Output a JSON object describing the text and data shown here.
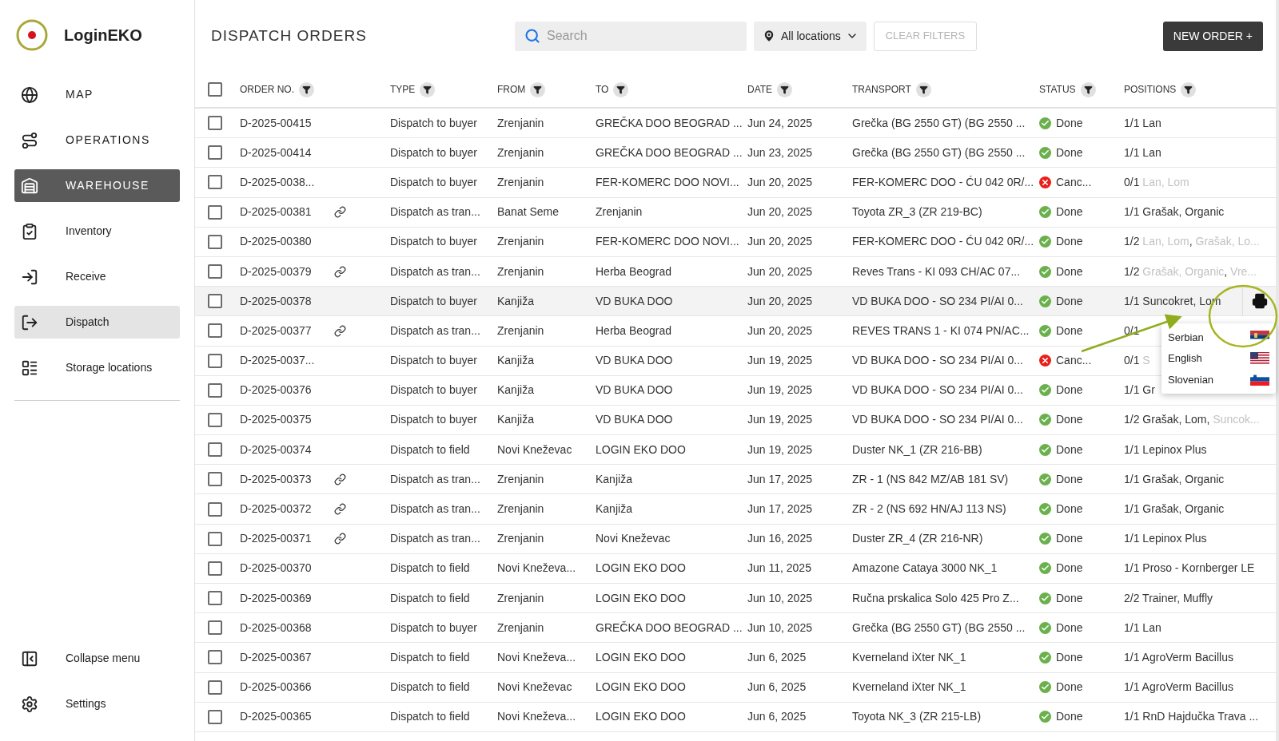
{
  "app": {
    "name": "LoginEKO"
  },
  "sidebar": {
    "items": [
      {
        "kind": "section",
        "label": "MAP",
        "selected": false
      },
      {
        "kind": "section",
        "label": "OPERATIONS",
        "selected": false
      },
      {
        "kind": "section",
        "label": "WAREHOUSE",
        "selected": true
      },
      {
        "kind": "item",
        "label": "Inventory",
        "selected": false
      },
      {
        "kind": "item",
        "label": "Receive",
        "selected": false
      },
      {
        "kind": "item",
        "label": "Dispatch",
        "selected": true
      },
      {
        "kind": "item",
        "label": "Storage locations",
        "selected": false
      }
    ],
    "footer": [
      {
        "label": "Collapse menu"
      },
      {
        "label": "Settings"
      }
    ]
  },
  "page": {
    "title": "DISPATCH ORDERS"
  },
  "toolbar": {
    "search": {
      "placeholder": "Search"
    },
    "location": {
      "value": "All locations"
    },
    "clear_filters": {
      "label": "CLEAR FILTERS",
      "disabled": true
    },
    "new_order": {
      "label": "NEW ORDER +"
    }
  },
  "table": {
    "select_all": {
      "checked": false
    },
    "columns": [
      "ORDER NO.",
      "TYPE",
      "FROM",
      "TO",
      "DATE",
      "TRANSPORT",
      "STATUS",
      "POSITIONS"
    ],
    "rows": [
      {
        "checked": false,
        "highlighted": false,
        "order": "D-2025-00415",
        "linked": false,
        "type": "Dispatch to buyer",
        "from": "Zrenjanin",
        "to": "GREČKA DOO BEOGRAD ...",
        "date": "Jun 24, 2025",
        "transport": "Grečka (BG 2550 GT) (BG 2550 ...",
        "status": {
          "kind": "done",
          "label": "Done"
        },
        "positions": {
          "count": "1/1",
          "parts": [
            {
              "text": "Lan",
              "muted": false
            }
          ]
        }
      },
      {
        "checked": false,
        "highlighted": false,
        "order": "D-2025-00414",
        "linked": false,
        "type": "Dispatch to buyer",
        "from": "Zrenjanin",
        "to": "GREČKA DOO BEOGRAD ...",
        "date": "Jun 23, 2025",
        "transport": "Grečka (BG 2550 GT) (BG 2550 ...",
        "status": {
          "kind": "done",
          "label": "Done"
        },
        "positions": {
          "count": "1/1",
          "parts": [
            {
              "text": "Lan",
              "muted": false
            }
          ]
        }
      },
      {
        "checked": false,
        "highlighted": false,
        "order": "D-2025-0038...",
        "linked": false,
        "type": "Dispatch to buyer",
        "from": "Zrenjanin",
        "to": "FER-KOMERC DOO NOVI...",
        "date": "Jun 20, 2025",
        "transport": "FER-KOMERC DOO - ĆU 042 0R/...",
        "status": {
          "kind": "cancelled",
          "label": "Canc..."
        },
        "positions": {
          "count": "0/1",
          "parts": [
            {
              "text": "Lan, Lom",
              "muted": true
            }
          ]
        }
      },
      {
        "checked": false,
        "highlighted": false,
        "order": "D-2025-00381",
        "linked": true,
        "type": "Dispatch as tran...",
        "from": "Banat Seme",
        "to": "Zrenjanin",
        "date": "Jun 20, 2025",
        "transport": "Toyota ZR_3 (ZR 219-BC)",
        "status": {
          "kind": "done",
          "label": "Done"
        },
        "positions": {
          "count": "1/1",
          "parts": [
            {
              "text": "Grašak, Organic",
              "muted": false
            }
          ]
        }
      },
      {
        "checked": false,
        "highlighted": false,
        "order": "D-2025-00380",
        "linked": false,
        "type": "Dispatch to buyer",
        "from": "Zrenjanin",
        "to": "FER-KOMERC DOO NOVI...",
        "date": "Jun 20, 2025",
        "transport": "FER-KOMERC DOO - ĆU 042 0R/...",
        "status": {
          "kind": "done",
          "label": "Done"
        },
        "positions": {
          "count": "1/2",
          "parts": [
            {
              "text": "Lan, Lom",
              "muted": true
            },
            {
              "text": ", ",
              "muted": false
            },
            {
              "text": "Grašak, Lo...",
              "muted": true
            }
          ]
        }
      },
      {
        "checked": false,
        "highlighted": false,
        "order": "D-2025-00379",
        "linked": true,
        "type": "Dispatch as tran...",
        "from": "Zrenjanin",
        "to": "Herba Beograd",
        "date": "Jun 20, 2025",
        "transport": "Reves Trans - KI 093 CH/AC 07...",
        "status": {
          "kind": "done",
          "label": "Done"
        },
        "positions": {
          "count": "1/2",
          "parts": [
            {
              "text": "Grašak, Organic",
              "muted": true
            },
            {
              "text": ", ",
              "muted": false
            },
            {
              "text": "Vre...",
              "muted": true
            }
          ]
        }
      },
      {
        "checked": false,
        "highlighted": true,
        "order": "D-2025-00378",
        "linked": false,
        "type": "Dispatch to buyer",
        "from": "Kanjiža",
        "to": "VD BUKA DOO",
        "date": "Jun 20, 2025",
        "transport": "VD BUKA DOO - SO 234 PI/AI 0...",
        "status": {
          "kind": "done",
          "label": "Done"
        },
        "positions": {
          "count": "1/1",
          "parts": [
            {
              "text": "Suncokret, Lom",
              "muted": false
            }
          ]
        }
      },
      {
        "checked": false,
        "highlighted": false,
        "order": "D-2025-00377",
        "linked": true,
        "type": "Dispatch as tran...",
        "from": "Zrenjanin",
        "to": "Herba Beograd",
        "date": "Jun 20, 2025",
        "transport": "REVES TRANS 1 - KI 074 PN/AC...",
        "status": {
          "kind": "done",
          "label": "Done"
        },
        "positions": {
          "count": "0/1"
        }
      },
      {
        "checked": false,
        "highlighted": false,
        "order": "D-2025-0037...",
        "linked": false,
        "type": "Dispatch to buyer",
        "from": "Kanjiža",
        "to": "VD BUKA DOO",
        "date": "Jun 19, 2025",
        "transport": "VD BUKA DOO - SO 234 PI/AI 0...",
        "status": {
          "kind": "cancelled",
          "label": "Canc..."
        },
        "positions": {
          "count": "0/1",
          "parts": [
            {
              "text": "S",
              "muted": true
            }
          ]
        }
      },
      {
        "checked": false,
        "highlighted": false,
        "order": "D-2025-00376",
        "linked": false,
        "type": "Dispatch to buyer",
        "from": "Kanjiža",
        "to": "VD BUKA DOO",
        "date": "Jun 19, 2025",
        "transport": "VD BUKA DOO - SO 234 PI/AI 0...",
        "status": {
          "kind": "done",
          "label": "Done"
        },
        "positions": {
          "count": "1/1",
          "parts": [
            {
              "text": "Gr",
              "muted": false
            }
          ]
        }
      },
      {
        "checked": false,
        "highlighted": false,
        "order": "D-2025-00375",
        "linked": false,
        "type": "Dispatch to buyer",
        "from": "Kanjiža",
        "to": "VD BUKA DOO",
        "date": "Jun 19, 2025",
        "transport": "VD BUKA DOO - SO 234 PI/AI 0...",
        "status": {
          "kind": "done",
          "label": "Done"
        },
        "positions": {
          "count": "1/2",
          "parts": [
            {
              "text": "Grašak, Lom, ",
              "muted": false
            },
            {
              "text": "Suncok...",
              "muted": true
            }
          ]
        }
      },
      {
        "checked": false,
        "highlighted": false,
        "order": "D-2025-00374",
        "linked": false,
        "type": "Dispatch to field",
        "from": "Novi Kneževac",
        "to": "LOGIN EKO DOO",
        "date": "Jun 19, 2025",
        "transport": "Duster NK_1 (ZR 216-BB)",
        "status": {
          "kind": "done",
          "label": "Done"
        },
        "positions": {
          "count": "1/1",
          "parts": [
            {
              "text": "Lepinox Plus",
              "muted": false
            }
          ]
        }
      },
      {
        "checked": false,
        "highlighted": false,
        "order": "D-2025-00373",
        "linked": true,
        "type": "Dispatch as tran...",
        "from": "Zrenjanin",
        "to": "Kanjiža",
        "date": "Jun 17, 2025",
        "transport": "ZR - 1 (NS 842 MZ/AB 181 SV)",
        "status": {
          "kind": "done",
          "label": "Done"
        },
        "positions": {
          "count": "1/1",
          "parts": [
            {
              "text": "Grašak, Organic",
              "muted": false
            }
          ]
        }
      },
      {
        "checked": false,
        "highlighted": false,
        "order": "D-2025-00372",
        "linked": true,
        "type": "Dispatch as tran...",
        "from": "Zrenjanin",
        "to": "Kanjiža",
        "date": "Jun 17, 2025",
        "transport": "ZR - 2 (NS 692 HN/AJ 113 NS)",
        "status": {
          "kind": "done",
          "label": "Done"
        },
        "positions": {
          "count": "1/1",
          "parts": [
            {
              "text": "Grašak, Organic",
              "muted": false
            }
          ]
        }
      },
      {
        "checked": false,
        "highlighted": false,
        "order": "D-2025-00371",
        "linked": true,
        "type": "Dispatch as tran...",
        "from": "Zrenjanin",
        "to": "Novi Kneževac",
        "date": "Jun 16, 2025",
        "transport": "Duster ZR_4 (ZR 216-NR)",
        "status": {
          "kind": "done",
          "label": "Done"
        },
        "positions": {
          "count": "1/1",
          "parts": [
            {
              "text": "Lepinox Plus",
              "muted": false
            }
          ]
        }
      },
      {
        "checked": false,
        "highlighted": false,
        "order": "D-2025-00370",
        "linked": false,
        "type": "Dispatch to field",
        "from": "Novi Kneževa...",
        "to": "LOGIN EKO DOO",
        "date": "Jun 11, 2025",
        "transport": "Amazone Cataya 3000 NK_1",
        "status": {
          "kind": "done",
          "label": "Done"
        },
        "positions": {
          "count": "1/1",
          "parts": [
            {
              "text": "Proso - Kornberger LE",
              "muted": false
            }
          ]
        }
      },
      {
        "checked": false,
        "highlighted": false,
        "order": "D-2025-00369",
        "linked": false,
        "type": "Dispatch to field",
        "from": "Zrenjanin",
        "to": "LOGIN EKO DOO",
        "date": "Jun 10, 2025",
        "transport": "Ručna prskalica Solo 425 Pro Z...",
        "status": {
          "kind": "done",
          "label": "Done"
        },
        "positions": {
          "count": "2/2",
          "parts": [
            {
              "text": "Trainer, Muffly",
              "muted": false
            }
          ]
        }
      },
      {
        "checked": false,
        "highlighted": false,
        "order": "D-2025-00368",
        "linked": false,
        "type": "Dispatch to buyer",
        "from": "Zrenjanin",
        "to": "GREČKA DOO BEOGRAD ...",
        "date": "Jun 10, 2025",
        "transport": "Grečka (BG 2550 GT) (BG 2550 ...",
        "status": {
          "kind": "done",
          "label": "Done"
        },
        "positions": {
          "count": "1/1",
          "parts": [
            {
              "text": "Lan",
              "muted": false
            }
          ]
        }
      },
      {
        "checked": false,
        "highlighted": false,
        "order": "D-2025-00367",
        "linked": false,
        "type": "Dispatch to field",
        "from": "Novi Kneževa...",
        "to": "LOGIN EKO DOO",
        "date": "Jun 6, 2025",
        "transport": "Kverneland iXter NK_1",
        "status": {
          "kind": "done",
          "label": "Done"
        },
        "positions": {
          "count": "1/1",
          "parts": [
            {
              "text": "AgroVerm Bacillus",
              "muted": false
            }
          ]
        }
      },
      {
        "checked": false,
        "highlighted": false,
        "order": "D-2025-00366",
        "linked": false,
        "type": "Dispatch to field",
        "from": "Novi Kneževac",
        "to": "LOGIN EKO DOO",
        "date": "Jun 6, 2025",
        "transport": "Kverneland iXter NK_1",
        "status": {
          "kind": "done",
          "label": "Done"
        },
        "positions": {
          "count": "1/1",
          "parts": [
            {
              "text": "AgroVerm Bacillus",
              "muted": false
            }
          ]
        }
      },
      {
        "checked": false,
        "highlighted": false,
        "order": "D-2025-00365",
        "linked": false,
        "type": "Dispatch to field",
        "from": "Novi Kneževa...",
        "to": "LOGIN EKO DOO",
        "date": "Jun 6, 2025",
        "transport": "Toyota NK_3 (ZR 215-LB)",
        "status": {
          "kind": "done",
          "label": "Done"
        },
        "positions": {
          "count": "1/1",
          "parts": [
            {
              "text": "RnD Hajdučka Trava ...",
              "muted": false
            }
          ]
        }
      }
    ]
  },
  "print_menu": {
    "items": [
      {
        "label": "Serbian"
      },
      {
        "label": "English"
      },
      {
        "label": "Slovenian"
      }
    ]
  }
}
